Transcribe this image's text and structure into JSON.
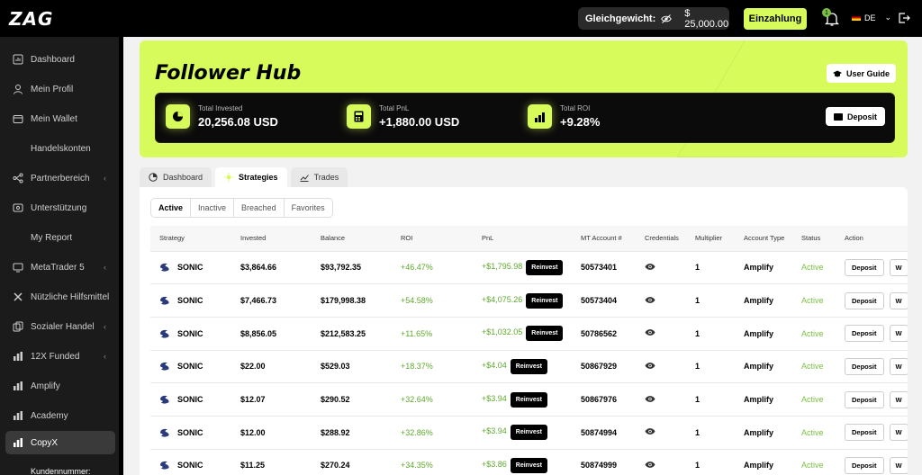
{
  "brand": {
    "logo": "ZAG",
    "accent": "#d7fb5a",
    "status_color": "#7bc043"
  },
  "topbar": {
    "balance_label": "Gleichgewicht:",
    "balance_value": "$ 25,000.00",
    "deposit_label": "Einzahlung",
    "notification_count": "1",
    "language": "DE"
  },
  "sidebar": {
    "items": [
      {
        "label": "Dashboard",
        "icon": "dashboard-icon"
      },
      {
        "label": "Mein Profil",
        "icon": "user-icon"
      },
      {
        "label": "Mein Wallet",
        "icon": "wallet-icon"
      },
      {
        "label": "Handelskonten",
        "icon": ""
      },
      {
        "label": "Partnerbereich",
        "icon": "network-icon"
      },
      {
        "label": "Unterstützung",
        "icon": "support-icon"
      },
      {
        "label": "My Report",
        "icon": ""
      },
      {
        "label": "MetaTrader 5",
        "icon": "monitor-icon"
      },
      {
        "label": "Nützliche Hilfsmittel",
        "icon": "tools-icon"
      },
      {
        "label": "Sozialer Handel",
        "icon": "copy-icon"
      },
      {
        "label": "12X Funded",
        "icon": "chart-icon"
      },
      {
        "label": "Amplify",
        "icon": "chart-icon"
      },
      {
        "label": "Academy",
        "icon": "chart-icon"
      },
      {
        "label": "CopyX",
        "icon": "chart-icon"
      }
    ],
    "customer_label": "Kundennummer:"
  },
  "hero": {
    "title": "Follower Hub",
    "user_guide": "User Guide",
    "deposit": "Deposit",
    "stats": [
      {
        "label": "Total Invested",
        "value": "20,256.08 USD"
      },
      {
        "label": "Total PnL",
        "value": "+1,880.00 USD"
      },
      {
        "label": "Total ROI",
        "value": "+9.28%"
      }
    ]
  },
  "tabs": [
    "Dashboard",
    "Strategies",
    "Trades"
  ],
  "subtabs": [
    "Active",
    "Inactive",
    "Breached",
    "Favorites"
  ],
  "table": {
    "headers": [
      "Strategy",
      "Invested",
      "Balance",
      "ROI",
      "PnL",
      "MT Account #",
      "Credentials",
      "Multiplier",
      "Account Type",
      "Status",
      "Action"
    ],
    "reinvest_label": "Reinvest",
    "deposit_label": "Deposit",
    "withdraw_label": "W",
    "rows": [
      {
        "strategy": "SONIC",
        "invested": "$3,864.66",
        "balance": "$93,792.35",
        "roi": "+46.47%",
        "pnl": "+$1,795.98",
        "account": "50573401",
        "multiplier": "1",
        "type": "Amplify",
        "status": "Active"
      },
      {
        "strategy": "SONIC",
        "invested": "$7,466.73",
        "balance": "$179,998.38",
        "roi": "+54.58%",
        "pnl": "+$4,075.26",
        "account": "50573404",
        "multiplier": "1",
        "type": "Amplify",
        "status": "Active"
      },
      {
        "strategy": "SONIC",
        "invested": "$8,856.05",
        "balance": "$212,583.25",
        "roi": "+11.65%",
        "pnl": "+$1,032.05",
        "account": "50786562",
        "multiplier": "1",
        "type": "Amplify",
        "status": "Active"
      },
      {
        "strategy": "SONIC",
        "invested": "$22.00",
        "balance": "$529.03",
        "roi": "+18.37%",
        "pnl": "+$4.04",
        "account": "50867929",
        "multiplier": "1",
        "type": "Amplify",
        "status": "Active"
      },
      {
        "strategy": "SONIC",
        "invested": "$12.07",
        "balance": "$290.52",
        "roi": "+32.64%",
        "pnl": "+$3.94",
        "account": "50867976",
        "multiplier": "1",
        "type": "Amplify",
        "status": "Active"
      },
      {
        "strategy": "SONIC",
        "invested": "$12.00",
        "balance": "$288.92",
        "roi": "+32.86%",
        "pnl": "+$3.94",
        "account": "50874994",
        "multiplier": "1",
        "type": "Amplify",
        "status": "Active"
      },
      {
        "strategy": "SONIC",
        "invested": "$11.25",
        "balance": "$270.24",
        "roi": "+34.35%",
        "pnl": "+$3.86",
        "account": "50874999",
        "multiplier": "1",
        "type": "Amplify",
        "status": "Active"
      }
    ]
  }
}
